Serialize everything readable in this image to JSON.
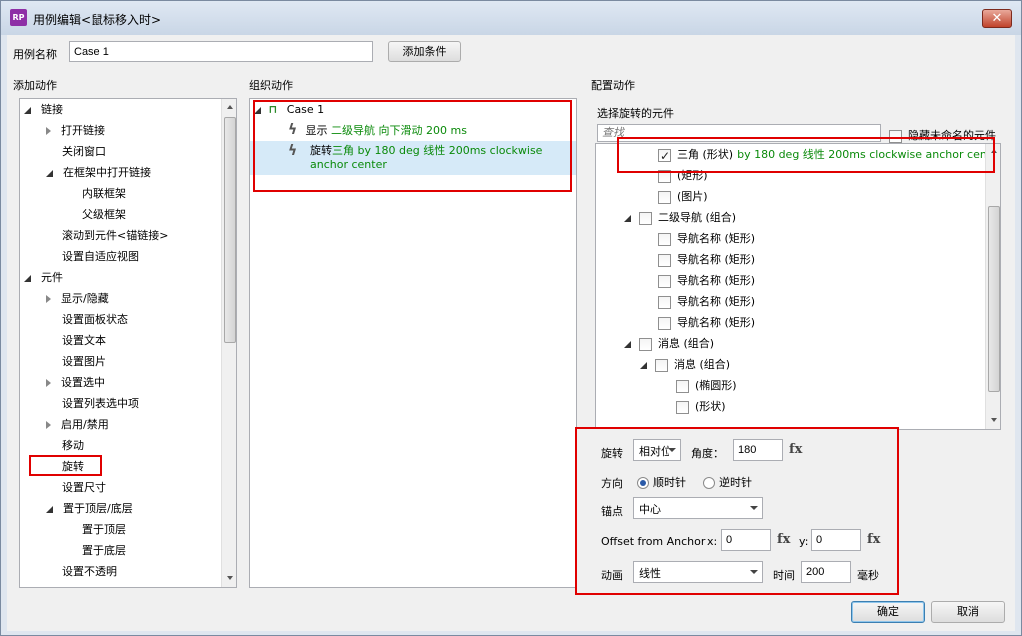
{
  "window": {
    "title": "用例编辑<鼠标移入时>",
    "app_icon_text": "RP",
    "close_glyph": "✕"
  },
  "case_name": {
    "label": "用例名称",
    "value": "Case 1",
    "add_condition": "添加条件"
  },
  "sections": {
    "add_actions": "添加动作",
    "organize_actions": "组织动作",
    "configure_actions": "配置动作"
  },
  "add_actions_tree": [
    {
      "label": "链接",
      "expander": "open"
    },
    {
      "label": "打开链接",
      "expander": "closed"
    },
    {
      "label": "关闭窗口",
      "expander": ""
    },
    {
      "label": "在框架中打开链接",
      "expander": "open"
    },
    {
      "label": "内联框架",
      "expander": ""
    },
    {
      "label": "父级框架",
      "expander": ""
    },
    {
      "label": "滚动到元件<锚链接>",
      "expander": ""
    },
    {
      "label": "设置自适应视图",
      "expander": ""
    },
    {
      "label": "元件",
      "expander": "open"
    },
    {
      "label": "显示/隐藏",
      "expander": "closed"
    },
    {
      "label": "设置面板状态",
      "expander": ""
    },
    {
      "label": "设置文本",
      "expander": ""
    },
    {
      "label": "设置图片",
      "expander": ""
    },
    {
      "label": "设置选中",
      "expander": "closed"
    },
    {
      "label": "设置列表选中项",
      "expander": ""
    },
    {
      "label": "启用/禁用",
      "expander": "closed"
    },
    {
      "label": "移动",
      "expander": ""
    },
    {
      "label": "旋转",
      "expander": ""
    },
    {
      "label": "设置尺寸",
      "expander": ""
    },
    {
      "label": "置于顶层/底层",
      "expander": "open"
    },
    {
      "label": "置于顶层",
      "expander": ""
    },
    {
      "label": "置于底层",
      "expander": ""
    },
    {
      "label": "设置不透明",
      "expander": ""
    }
  ],
  "organize": {
    "case_label": "Case 1",
    "actions": [
      {
        "verb": "显示",
        "detail": "二级导航 向下滑动 200 ms"
      },
      {
        "verb": "旋转",
        "detail": "三角 by 180 deg 线性 200ms clockwise anchor center"
      }
    ]
  },
  "configure": {
    "select_label": "选择旋转的元件",
    "search_placeholder": "查找",
    "hide_unnamed": "隐藏未命名的元件",
    "widgets": [
      {
        "label": "三角 (形状)",
        "detail": "by 180 deg 线性 200ms clockwise anchor center",
        "checked": true,
        "expander": ""
      },
      {
        "label": "(矩形)",
        "detail": "",
        "checked": false,
        "expander": ""
      },
      {
        "label": "(图片)",
        "detail": "",
        "checked": false,
        "expander": ""
      },
      {
        "label": "二级导航 (组合)",
        "detail": "",
        "checked": false,
        "expander": "open"
      },
      {
        "label": "导航名称 (矩形)",
        "detail": "",
        "checked": false,
        "expander": ""
      },
      {
        "label": "导航名称 (矩形)",
        "detail": "",
        "checked": false,
        "expander": ""
      },
      {
        "label": "导航名称 (矩形)",
        "detail": "",
        "checked": false,
        "expander": ""
      },
      {
        "label": "导航名称 (矩形)",
        "detail": "",
        "checked": false,
        "expander": ""
      },
      {
        "label": "导航名称 (矩形)",
        "detail": "",
        "checked": false,
        "expander": ""
      },
      {
        "label": "消息 (组合)",
        "detail": "",
        "checked": false,
        "expander": "open"
      },
      {
        "label": "消息 (组合)",
        "detail": "",
        "checked": false,
        "expander": "open"
      },
      {
        "label": "(椭圆形)",
        "detail": "",
        "checked": false,
        "expander": ""
      },
      {
        "label": "(形状)",
        "detail": "",
        "checked": false,
        "expander": ""
      }
    ],
    "rotate": {
      "label": "旋转",
      "mode": "相对位",
      "angle_label": "角度：",
      "angle": "180",
      "fx": "fx"
    },
    "direction": {
      "label": "方向",
      "clockwise": "顺时针",
      "counterclockwise": "逆时针",
      "selected": "clockwise"
    },
    "anchor": {
      "label": "锚点",
      "value": "中心"
    },
    "offset": {
      "label": "Offset from Anchor",
      "x_label": "x:",
      "x": "0",
      "y_label": "y:",
      "y": "0"
    },
    "animation": {
      "label": "动画",
      "value": "线性",
      "time_label": "时间",
      "time": "200",
      "unit": "毫秒"
    }
  },
  "footer": {
    "ok": "确定",
    "cancel": "取消"
  },
  "colors": {
    "highlight": "#e00000",
    "action_text": "#0a8a0a",
    "selection": "#d6eaf8"
  }
}
